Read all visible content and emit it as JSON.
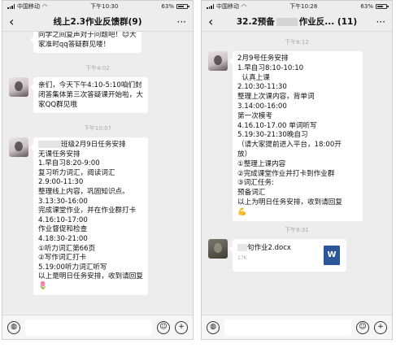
{
  "left": {
    "status": {
      "carrier": "中国移动",
      "time": "下午10:30",
      "battery": "63%"
    },
    "nav": {
      "back": "‹",
      "title": "线上2.3作业反馈群(9)",
      "more": "···"
    },
    "top_fragment": [
      "同学之间复声对于问题吧！😊大",
      "家准时qq答疑群见喽！"
    ],
    "ts1": "下午4:02",
    "msg1": [
      "亲们，今天下午4:10-5:10咱们封",
      "闭答集体第三次答疑课开始啦，大",
      "家QQ群见哦"
    ],
    "ts2": "下午10:07",
    "msg2": [
      "班级2月9日任务安排",
      "无课任务安排",
      "1.早自习8:20-9:00",
      "复习听力词汇，阅读词汇",
      "2.9:00-11:30",
      "整理线上内容，巩固知识点。",
      "3.13:30-16:00",
      "完成课堂作业，并在作业群打卡",
      "4.16:10-17:00",
      "作业督促和检查",
      "4.18:30-21:00",
      "①听力词汇第66页",
      "②写作词汇打卡",
      "5.19:00听力词汇听写",
      "以上是明日任务安排，收到请回复",
      "🌷"
    ],
    "input": {
      "placeholder": ""
    }
  },
  "right": {
    "status": {
      "carrier": "中国移动",
      "time": "下午10:28",
      "battery": "63%"
    },
    "nav": {
      "back": "‹",
      "title_left": "32.2预备",
      "title_right": "作业反...  (11)",
      "more": "···"
    },
    "ts1": "下午8:12",
    "msg1": [
      "2月9号任务安排",
      "1.早自习8:10-10:10",
      "  认真上课",
      "",
      "2.10:30-11:30",
      "整理上次课内容，背单词",
      "",
      "3.14:00-16:00",
      "第一次模考",
      "",
      "4.16.10-17.00 单词听写",
      "",
      "5.19:30-21:30晚自习",
      "（请大家提前进入平台，18:00开",
      "放）",
      "①整理上课内容",
      "②完成课堂作业并打卡到作业群",
      "③词汇任务:",
      "预备词汇",
      "以上为明日任务安排，收到请回复",
      "💪"
    ],
    "ts2": "下午8:31",
    "file": {
      "name": "句作业2.docx",
      "size": "17K",
      "icon_letter": "W"
    },
    "input": {
      "placeholder": ""
    }
  },
  "colors": {
    "chat_bg": "#ededed",
    "bubble": "#ffffff",
    "timestamp": "#a8a8a8",
    "word_blue": "#2b579a"
  },
  "icons": [
    "back-arrow-icon",
    "more-icon",
    "voice-icon",
    "emoji-icon",
    "plus-icon",
    "signal-icon",
    "wifi-icon",
    "battery-icon",
    "word-doc-icon"
  ]
}
